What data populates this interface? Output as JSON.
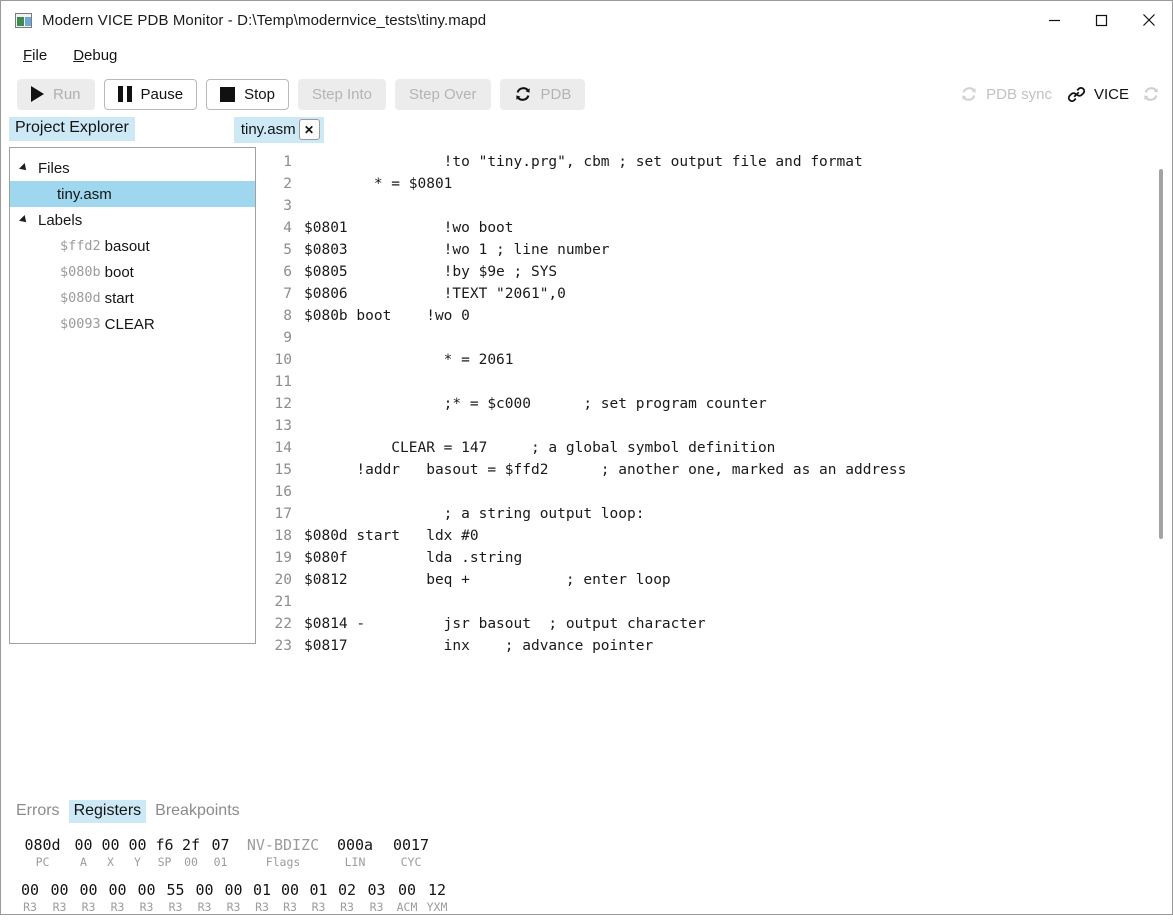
{
  "window": {
    "title": "Modern VICE PDB Monitor - D:\\Temp\\modernvice_tests\\tiny.mapd",
    "app_icon": "window-icon",
    "controls": {
      "minimize": "minimize-icon",
      "maximize": "maximize-icon",
      "close": "close-icon"
    }
  },
  "menubar": {
    "items": [
      {
        "label": "File",
        "mnemonic": "F"
      },
      {
        "label": "Debug",
        "mnemonic": "D"
      }
    ]
  },
  "toolbar": {
    "buttons": [
      {
        "label": "Run",
        "icon": "play-icon",
        "state": "hovered"
      },
      {
        "label": "Pause",
        "icon": "pause-icon",
        "state": "enabled"
      },
      {
        "label": "Stop",
        "icon": "stop-icon",
        "state": "enabled"
      },
      {
        "label": "Step Into",
        "icon": "",
        "state": "disabled"
      },
      {
        "label": "Step Over",
        "icon": "",
        "state": "disabled"
      },
      {
        "label": "PDB",
        "icon": "refresh-icon",
        "state": "disabled"
      }
    ],
    "status": {
      "pdb_sync_label": "PDB sync",
      "pdb_sync_icon": "refresh-icon",
      "vice_label": "VICE",
      "vice_icon": "link-icon",
      "refresh_icon": "refresh-icon"
    }
  },
  "sidebar": {
    "header": "Project Explorer",
    "tree": [
      {
        "type": "group",
        "label": "Files",
        "expanded": true
      },
      {
        "type": "file",
        "label": "tiny.asm",
        "selected": true
      },
      {
        "type": "group",
        "label": "Labels",
        "expanded": true
      },
      {
        "type": "label",
        "addr": "$ffd2",
        "name": "basout"
      },
      {
        "type": "label",
        "addr": "$080b",
        "name": "boot"
      },
      {
        "type": "label",
        "addr": "$080d",
        "name": "start"
      },
      {
        "type": "label",
        "addr": "$0093",
        "name": "CLEAR"
      }
    ]
  },
  "editor": {
    "tab": {
      "label": "tiny.asm",
      "close_label": "✕",
      "active": true
    },
    "lines": [
      {
        "n": "1",
        "text": "                !to \"tiny.prg\", cbm ; set output file and format"
      },
      {
        "n": "2",
        "text": "        * = $0801"
      },
      {
        "n": "3",
        "text": ""
      },
      {
        "n": "4",
        "text": "$0801           !wo boot"
      },
      {
        "n": "5",
        "text": "$0803           !wo 1 ; line number"
      },
      {
        "n": "6",
        "text": "$0805           !by $9e ; SYS"
      },
      {
        "n": "7",
        "text": "$0806           !TEXT \"2061\",0"
      },
      {
        "n": "8",
        "text": "$080b boot    !wo 0"
      },
      {
        "n": "9",
        "text": ""
      },
      {
        "n": "10",
        "text": "                * = 2061"
      },
      {
        "n": "11",
        "text": ""
      },
      {
        "n": "12",
        "text": "                ;* = $c000      ; set program counter"
      },
      {
        "n": "13",
        "text": ""
      },
      {
        "n": "14",
        "text": "          CLEAR = 147     ; a global symbol definition"
      },
      {
        "n": "15",
        "text": "      !addr   basout = $ffd2      ; another one, marked as an address"
      },
      {
        "n": "16",
        "text": ""
      },
      {
        "n": "17",
        "text": "                ; a string output loop:"
      },
      {
        "n": "18",
        "text": "$080d start   ldx #0"
      },
      {
        "n": "19",
        "text": "$080f         lda .string"
      },
      {
        "n": "20",
        "text": "$0812         beq +           ; enter loop"
      },
      {
        "n": "21",
        "text": ""
      },
      {
        "n": "22",
        "text": "$0814 -         jsr basout  ; output character"
      },
      {
        "n": "23",
        "text": "$0817           inx    ; advance pointer"
      }
    ]
  },
  "bottom_panel": {
    "tabs": [
      {
        "label": "Errors",
        "active": false
      },
      {
        "label": "Registers",
        "active": true
      },
      {
        "label": "Breakpoints",
        "active": false
      }
    ],
    "registers_row1": [
      {
        "value": "080d",
        "name": "PC",
        "muted": false
      },
      {
        "value": "00",
        "name": "A",
        "muted": false
      },
      {
        "value": "00",
        "name": "X",
        "muted": false
      },
      {
        "value": "00",
        "name": "Y",
        "muted": false
      },
      {
        "value": "f6",
        "name": "SP",
        "muted": false
      },
      {
        "value": "2f",
        "name": "00",
        "muted": false
      },
      {
        "value": "07",
        "name": "01",
        "muted": false
      },
      {
        "value": "NV-BDIZC",
        "name": "Flags",
        "muted": true
      },
      {
        "value": "000a",
        "name": "LIN",
        "muted": false
      },
      {
        "value": "0017",
        "name": "CYC",
        "muted": false
      }
    ],
    "registers_row2": [
      {
        "value": "00",
        "name": "R3"
      },
      {
        "value": "00",
        "name": "R3"
      },
      {
        "value": "00",
        "name": "R3"
      },
      {
        "value": "00",
        "name": "R3"
      },
      {
        "value": "00",
        "name": "R3"
      },
      {
        "value": "55",
        "name": "R3"
      },
      {
        "value": "00",
        "name": "R3"
      },
      {
        "value": "00",
        "name": "R3"
      },
      {
        "value": "01",
        "name": "R3"
      },
      {
        "value": "00",
        "name": "R3"
      },
      {
        "value": "01",
        "name": "R3"
      },
      {
        "value": "02",
        "name": "R3"
      },
      {
        "value": "03",
        "name": "R3"
      },
      {
        "value": "00",
        "name": "ACM"
      },
      {
        "value": "12",
        "name": "YXM"
      }
    ]
  },
  "colors": {
    "accent_selection": "#9fd7ef",
    "accent_tab": "#cce9f5",
    "muted_text": "#9c9c9c",
    "border": "#a0a0a0"
  }
}
